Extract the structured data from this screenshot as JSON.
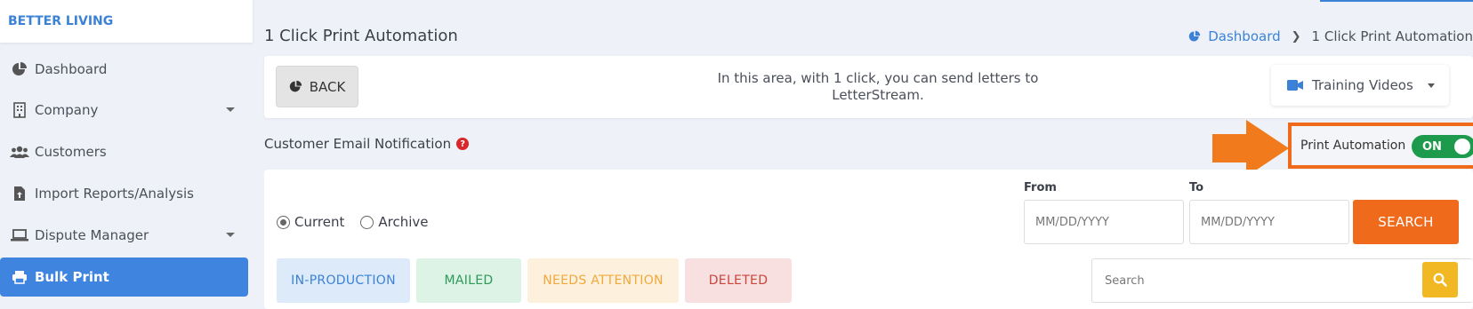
{
  "brand": "BETTER LIVING",
  "sidebar": {
    "items": [
      {
        "label": "Dashboard",
        "icon": "pie-chart-icon"
      },
      {
        "label": "Company",
        "icon": "building-icon",
        "has_caret": true
      },
      {
        "label": "Customers",
        "icon": "users-icon"
      },
      {
        "label": "Import Reports/Analysis",
        "icon": "file-upload-icon"
      },
      {
        "label": "Dispute Manager",
        "icon": "laptop-icon",
        "has_caret": true
      },
      {
        "label": "Bulk Print",
        "icon": "printer-icon",
        "active": true
      }
    ]
  },
  "header": {
    "title": "1 Click Print Automation",
    "breadcrumb": {
      "home": "Dashboard",
      "current": "1 Click Print Automation"
    }
  },
  "toolbar": {
    "back_label": "BACK",
    "info_text": "In this area, with 1 click, you can send letters to LetterStream.",
    "training_label": "Training Videos"
  },
  "notification": {
    "label": "Customer Email Notification",
    "help": "?"
  },
  "automation": {
    "label": "Print Automation",
    "toggle_state": "ON"
  },
  "filters": {
    "radio_current": "Current",
    "radio_archive": "Archive",
    "from_label": "From",
    "to_label": "To",
    "from_placeholder": "MM/DD/YYYY",
    "to_placeholder": "MM/DD/YYYY",
    "search_button": "SEARCH",
    "search_placeholder": "Search"
  },
  "tabs": {
    "in_production": "IN-PRODUCTION",
    "mailed": "MAILED",
    "needs_attention": "NEEDS ATTENTION",
    "deleted": "DELETED"
  },
  "colors": {
    "primary": "#3f84de",
    "accent_orange": "#f06a1c",
    "toggle_on": "#1e9a4c",
    "search_yellow": "#f2b824"
  }
}
